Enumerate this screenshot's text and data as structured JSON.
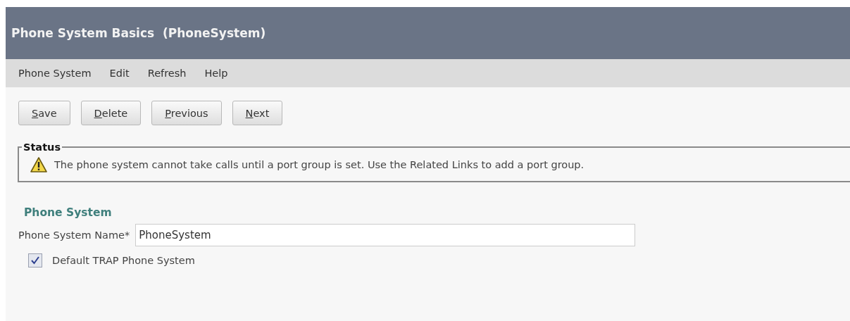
{
  "window": {
    "title": "Phone System Basics  (PhoneSystem)"
  },
  "menu": [
    "Phone System",
    "Edit",
    "Refresh",
    "Help"
  ],
  "buttons": [
    {
      "mnemonic": "S",
      "rest": "ave"
    },
    {
      "mnemonic": "D",
      "rest": "elete"
    },
    {
      "mnemonic": "P",
      "rest": "revious"
    },
    {
      "mnemonic": "N",
      "rest": "ext"
    }
  ],
  "status": {
    "legend": "Status",
    "message": "The phone system cannot take calls until a port group is set. Use the Related Links to add a port group."
  },
  "section": {
    "heading": "Phone System",
    "name_label": "Phone System Name*",
    "name_value": "PhoneSystem",
    "checkbox": {
      "label": "Default TRAP Phone System",
      "checked": true
    }
  }
}
